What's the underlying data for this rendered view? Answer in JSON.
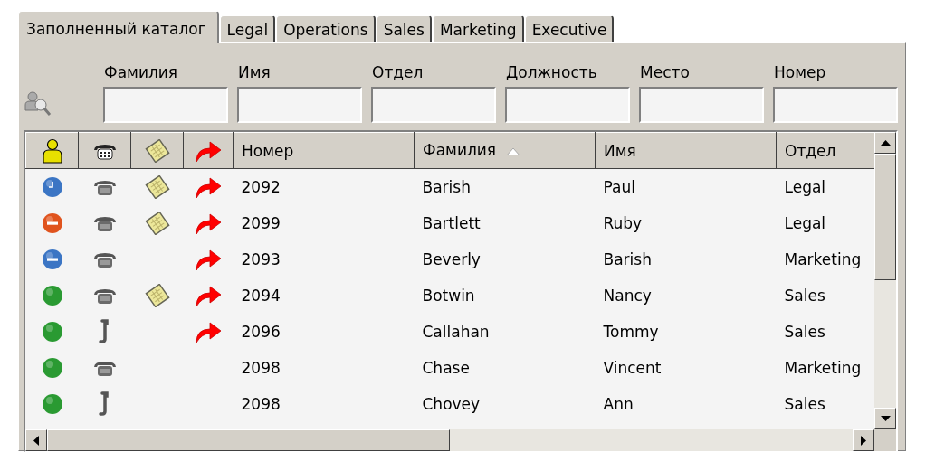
{
  "tabs": [
    {
      "label": "Заполненный каталог",
      "selected": true
    },
    {
      "label": "Legal",
      "selected": false
    },
    {
      "label": "Operations",
      "selected": false
    },
    {
      "label": "Sales",
      "selected": false
    },
    {
      "label": "Marketing",
      "selected": false
    },
    {
      "label": "Executive",
      "selected": false
    }
  ],
  "filters": [
    {
      "label": "Фамилия"
    },
    {
      "label": "Имя"
    },
    {
      "label": "Отдел"
    },
    {
      "label": "Должность"
    },
    {
      "label": "Место"
    },
    {
      "label": "Номер"
    }
  ],
  "table": {
    "columns": [
      {
        "kind": "presence-icon"
      },
      {
        "kind": "phone-icon"
      },
      {
        "kind": "note-icon"
      },
      {
        "kind": "forward-icon"
      },
      {
        "kind": "text",
        "label": "Номер",
        "sorted": false
      },
      {
        "kind": "text",
        "label": "Фамилия",
        "sorted": true
      },
      {
        "kind": "text",
        "label": "Имя",
        "sorted": false
      },
      {
        "kind": "text",
        "label": "Отдел",
        "sorted": false
      }
    ],
    "rows": [
      {
        "presence": {
          "kind": "away",
          "color": "#3b75c4"
        },
        "phone": {
          "kind": "desk"
        },
        "note": true,
        "forward": true,
        "number": "2092",
        "last_name": "Barish",
        "first_name": "Paul",
        "department": "Legal"
      },
      {
        "presence": {
          "kind": "busy",
          "color": "#e0531d"
        },
        "phone": {
          "kind": "desk"
        },
        "note": true,
        "forward": true,
        "number": "2099",
        "last_name": "Bartlett",
        "first_name": "Ruby",
        "department": "Legal"
      },
      {
        "presence": {
          "kind": "blocked",
          "color": "#3b75c4"
        },
        "phone": {
          "kind": "desk"
        },
        "note": false,
        "forward": true,
        "number": "2093",
        "last_name": "Beverly",
        "first_name": "Barish",
        "department": "Marketing"
      },
      {
        "presence": {
          "kind": "available",
          "color": "#2a9a32"
        },
        "phone": {
          "kind": "desk"
        },
        "note": true,
        "forward": true,
        "number": "2094",
        "last_name": "Botwin",
        "first_name": "Nancy",
        "department": "Sales"
      },
      {
        "presence": {
          "kind": "available",
          "color": "#2a9a32"
        },
        "phone": {
          "kind": "handset"
        },
        "note": false,
        "forward": true,
        "number": "2096",
        "last_name": "Callahan",
        "first_name": "Tommy",
        "department": "Sales"
      },
      {
        "presence": {
          "kind": "available",
          "color": "#2a9a32"
        },
        "phone": {
          "kind": "desk"
        },
        "note": false,
        "forward": false,
        "number": "2098",
        "last_name": "Chase",
        "first_name": "Vincent",
        "department": "Marketing"
      },
      {
        "presence": {
          "kind": "available",
          "color": "#2a9a32"
        },
        "phone": {
          "kind": "handset"
        },
        "note": false,
        "forward": false,
        "number": "2098",
        "last_name": "Chovey",
        "first_name": "Ann",
        "department": "Sales"
      }
    ]
  }
}
